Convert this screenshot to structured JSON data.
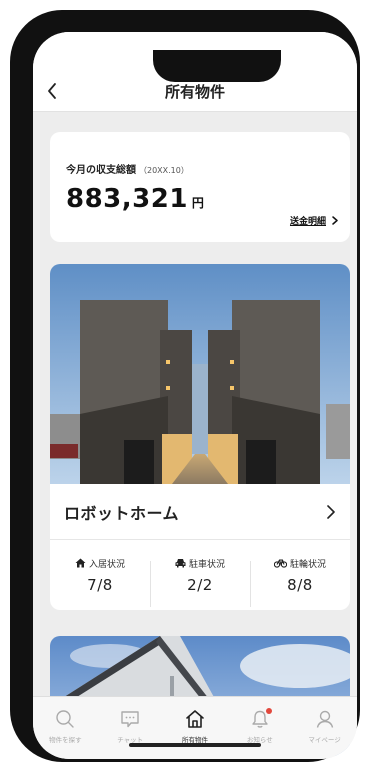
{
  "header": {
    "title": "所有物件"
  },
  "balance": {
    "label": "今月の収支総額",
    "period": "（20XX.10）",
    "amount": "883,321",
    "unit": "円",
    "link_label": "送金明細"
  },
  "property": {
    "name": "ロボットホーム",
    "stats": [
      {
        "icon": "house-icon",
        "label": "入居状況",
        "value": "7/8"
      },
      {
        "icon": "car-icon",
        "label": "駐車状況",
        "value": "2/2"
      },
      {
        "icon": "bicycle-icon",
        "label": "駐輪状況",
        "value": "8/8"
      }
    ]
  },
  "tabs": [
    {
      "icon": "search-icon",
      "label": "物件を探す",
      "active": false
    },
    {
      "icon": "chat-icon",
      "label": "チャット",
      "active": false
    },
    {
      "icon": "home-icon",
      "label": "所有物件",
      "active": true
    },
    {
      "icon": "bell-icon",
      "label": "お知らせ",
      "active": false,
      "badge": true
    },
    {
      "icon": "user-icon",
      "label": "マイページ",
      "active": false
    }
  ],
  "colors": {
    "badge": "#e2483d",
    "background": "#ededed",
    "text": "#222222"
  }
}
